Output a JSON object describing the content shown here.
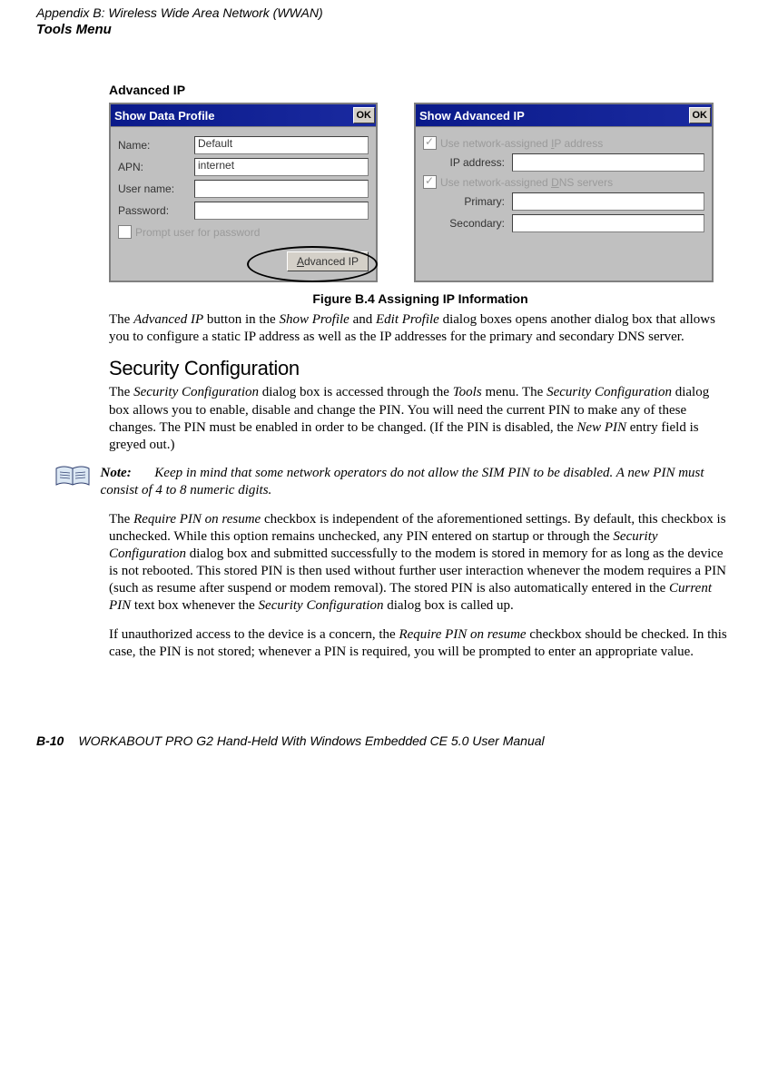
{
  "header": {
    "appendix": "Appendix  B:  Wireless Wide Area Network (WWAN)",
    "section": "Tools Menu"
  },
  "advanced_ip_heading": "Advanced IP",
  "window1": {
    "title": "Show Data Profile",
    "ok": "OK",
    "name_label": "Name:",
    "name_value": "Default",
    "apn_label": "APN:",
    "apn_value": "internet",
    "user_label": "User name:",
    "user_value": "",
    "pwd_label": "Password:",
    "pwd_value": "",
    "prompt_label": "Prompt user for password",
    "adv_button_underline": "A",
    "adv_button_rest": "dvanced IP"
  },
  "window2": {
    "title": "Show Advanced IP",
    "ok": "OK",
    "use_ip_underline": "I",
    "use_ip_rest": "P address",
    "use_ip_prefix": "Use network-assigned ",
    "ip_label": "IP address:",
    "ip_value": "",
    "use_dns_prefix": "Use network-assigned ",
    "use_dns_underline": "D",
    "use_dns_rest": "NS servers",
    "primary_label": "Primary:",
    "primary_value": "",
    "secondary_label": "Secondary:",
    "secondary_value": ""
  },
  "figure_caption": "Figure B.4   Assigning IP Information",
  "para1": {
    "p1_a": "The ",
    "p1_b": "Advanced IP",
    "p1_c": " button in the ",
    "p1_d": "Show Profile",
    "p1_e": " and ",
    "p1_f": "Edit Profile",
    "p1_g": " dialog boxes opens another dialog box that allows you to configure a static IP address as well as the IP addresses for the primary and secondary DNS server."
  },
  "sec_config_heading": "Security Configuration",
  "para2": {
    "a": "The ",
    "b": "Security Configuration",
    "c": " dialog box is accessed through the ",
    "d": "Tools",
    "e": " menu. The ",
    "f": "Security Configuration",
    "g": " dialog box allows you to enable, disable and change the PIN. You will need the current PIN to make any of these changes. The PIN must be enabled in order to be changed. (If the PIN is disabled, the ",
    "h": "New PIN",
    "i": " entry field is greyed out.)"
  },
  "note": {
    "label": "Note:",
    "text": "Keep in mind that some network operators do not allow the SIM PIN to be disabled. A new PIN must consist of 4 to 8 numeric digits."
  },
  "para3": {
    "a": "The ",
    "b": "Require PIN  on resume",
    "c": " checkbox is independent of the aforementioned settings. By default, this checkbox is unchecked. While this option remains unchecked, any PIN entered on startup or through the ",
    "d": "Security Configuration",
    "e": " dialog box and submitted successfully to the modem is stored in memory for as long as the device is not rebooted. This stored PIN is then used without further user interaction whenever the modem requires a PIN (such as resume after suspend or modem removal). The stored PIN is also automatically entered in the ",
    "f": "Current PIN",
    "g": " text box whenever the ",
    "h": "Security Configuration",
    "i": " dialog box is called up."
  },
  "para4": {
    "a": "If unauthorized access to the device is a concern, the ",
    "b": "Require PIN on resume",
    "c": " checkbox should be checked. In this case, the PIN is not stored; whenever a PIN is required, you will be prompted to enter an appropriate value."
  },
  "footer": {
    "page": "B-10",
    "manual": "WORKABOUT PRO G2 Hand-Held With Windows Embedded CE 5.0 User Manual"
  }
}
